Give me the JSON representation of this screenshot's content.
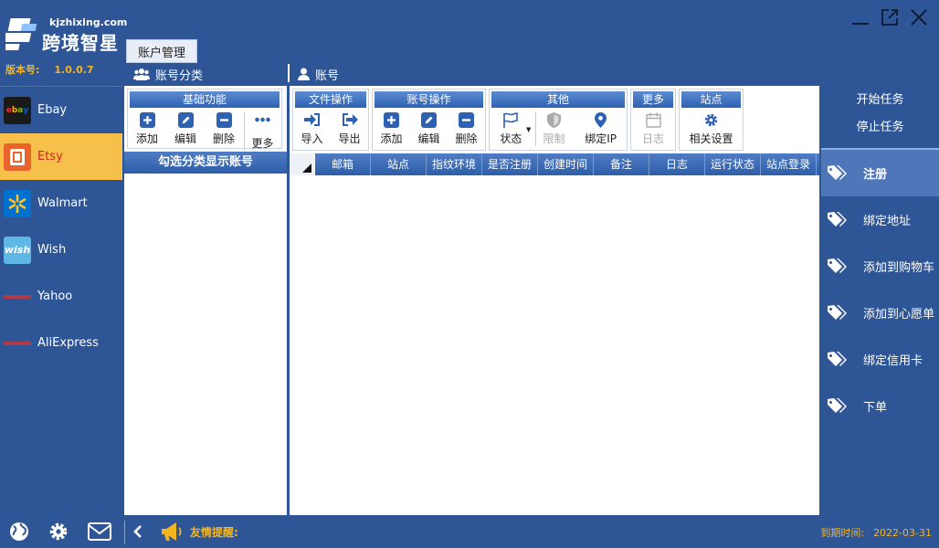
{
  "app": {
    "site": "kjzhixing.com",
    "name": "跨境智星",
    "version_label": "版本号:",
    "version": "1.0.0.7",
    "top_tab": "账户管理"
  },
  "sections": {
    "category": "账号分类",
    "account": "账号"
  },
  "platforms": [
    {
      "label": "Ebay",
      "icon": "ebay-logo",
      "active": false
    },
    {
      "label": "Etsy",
      "icon": "etsy-logo",
      "active": true
    },
    {
      "label": "Walmart",
      "icon": "walmart-logo",
      "active": false
    },
    {
      "label": "Wish",
      "icon": "wish-logo",
      "active": false
    },
    {
      "label": "Yahoo",
      "icon": "yahoo-logo",
      "active": false
    },
    {
      "label": "AliExpress",
      "icon": "aliexpress-logo",
      "active": false
    }
  ],
  "category_panel": {
    "group_title": "基础功能",
    "buttons": [
      "添加",
      "编辑",
      "删除",
      "更多"
    ],
    "caption": "勾选分类显示账号"
  },
  "account_panel": {
    "groups": [
      {
        "title": "文件操作",
        "buttons": [
          "导入",
          "导出"
        ]
      },
      {
        "title": "账号操作",
        "buttons": [
          "添加",
          "编辑",
          "删除"
        ]
      },
      {
        "title": "其他",
        "buttons": [
          "状态",
          "限制",
          "绑定IP"
        ]
      },
      {
        "title": "更多",
        "buttons": [
          "日志"
        ]
      },
      {
        "title": "站点",
        "buttons": [
          "相关设置"
        ]
      }
    ],
    "columns": [
      "邮箱",
      "站点",
      "指纹环境",
      "是否注册",
      "创建时间",
      "备注",
      "日志",
      "运行状态",
      "站点登录"
    ]
  },
  "task_panel": {
    "start": "开始任务",
    "stop": "停止任务",
    "tasks": [
      {
        "label": "注册",
        "active": true
      },
      {
        "label": "绑定地址",
        "active": false
      },
      {
        "label": "添加到购物车",
        "active": false
      },
      {
        "label": "添加到心愿单",
        "active": false
      },
      {
        "label": "绑定信用卡",
        "active": false
      },
      {
        "label": "下单",
        "active": false
      }
    ]
  },
  "footer": {
    "notice_label": "友情提醒:",
    "expire_label": "到期时间:",
    "expire_date": "2022-03-31"
  },
  "colors": {
    "background": "#2e5596",
    "accent_yellow": "#f5b51e",
    "active_platform": "#f7c04a"
  }
}
